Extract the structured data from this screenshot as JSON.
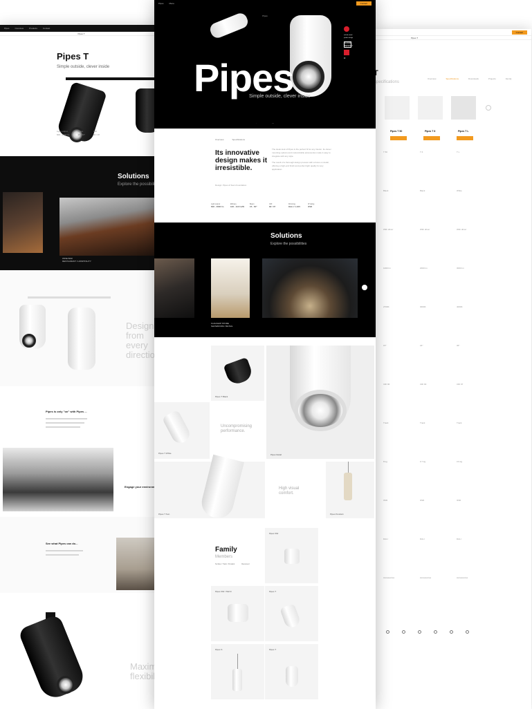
{
  "center": {
    "nav": {
      "items": [
        "Pipes",
        "Menu"
      ],
      "cta": "Contact"
    },
    "subnav": [
      "Pipes"
    ],
    "hero": {
      "title": "Pipes",
      "subtitle": "Simple outside, clever inside",
      "tabs": [
        "",
        ""
      ]
    },
    "awards": [
      "red dot award product design",
      "GOOD DESIGN",
      "iF"
    ],
    "intro": {
      "tabs": [
        "Overview",
        "Specifications"
      ],
      "heading": "Its innovative design makes it irresistible.",
      "note": "Design: Pipes & Team Foundation",
      "paragraphs": [
        "The sleek look of Pipes is the perfect fit for any interior. Its clever mounting options and customizable accessories make it easy to integrate with any style.",
        "The result of a thorough design process with a focus on detail, offering a high-end finish and perfect light quality for any application."
      ],
      "specs": [
        {
          "k": "Light output",
          "v": "600 - 3600 lm"
        },
        {
          "k": "Efficacy",
          "v": "100 - 110 lm/W"
        },
        {
          "k": "Beam",
          "v": "15 - 60°"
        },
        {
          "k": "CRI",
          "v": "90 / 97"
        },
        {
          "k": "Dimming",
          "v": "DALI / 1-10V"
        },
        {
          "k": "IP rating",
          "v": "IP20"
        }
      ]
    },
    "solutions": {
      "title": "Solutions",
      "subtitle": "Explore the possibilities",
      "caption": [
        "FLAGSHIP STORE",
        "SHOWROOM / RETAIL"
      ]
    },
    "gallery": {
      "labels": [
        "Pipes T Black",
        "Pipes T White",
        "Pipes Detail",
        "Pipes T Sun",
        "Pipes Pendant"
      ],
      "texts": [
        "Uncompromising performance.",
        "High visual comfort."
      ]
    },
    "family": {
      "title": "Family",
      "subtitle": "Members",
      "links": [
        "Surface / Track / Pendant",
        "Recessed"
      ],
      "cards": [
        "Pipes SW",
        "Pipes SW / SW-D",
        "Pipes T",
        "Pipes S",
        "Pipes T"
      ]
    }
  },
  "left": {
    "nav": {
      "items": [
        "Pipes",
        "Overview",
        "Products",
        "Contact"
      ],
      "cta": ""
    },
    "subnav": [
      "Pipes T"
    ],
    "title": "Pipes T",
    "subtitle": "Simple outside, clever inside",
    "specs": [
      "Light output",
      "600 - 2400 lm",
      "Beam",
      "15 - 60°",
      "CRI",
      "90 / 97"
    ],
    "solutions": {
      "title": "Solutions",
      "subtitle": "Explore the possibilities",
      "caption": [
        "WINE BAR",
        "RESTAURANT / HOSPITALITY"
      ]
    },
    "big_texts": [
      "Design from every direction",
      "Maximum flexibility"
    ],
    "heads": [
      "Pipes is only \"on\" with Pipes ...",
      "Engage your environment",
      "See what Pipes can do..."
    ]
  },
  "right": {
    "nav": {
      "cta": "Contact"
    },
    "subnav": [
      "Pipes T"
    ],
    "title": "T",
    "subtitle": "Specifications",
    "tabs": [
      "Overview",
      "Specifications",
      "Downloads",
      "Projects",
      "Family"
    ],
    "columns": [
      "Pipes T 50",
      "Pipes T 6",
      "Pipes T L"
    ],
    "rows": [
      [
        "T 50",
        "T 6",
        "T L"
      ],
      [
        "Black",
        "Black",
        "White"
      ],
      [
        "With driver",
        "With driver",
        "With driver"
      ],
      [
        "1000 lm",
        "2000 lm",
        "3000 lm"
      ],
      [
        "2700K",
        "3000K",
        "4000K"
      ],
      [
        "15°",
        "24°",
        "36°"
      ],
      [
        "CRI 90",
        "CRI 90",
        "CRI 97"
      ],
      [
        "Track",
        "Track",
        "Track"
      ],
      [
        "8 kg",
        "0.7 kg",
        "0.9 kg"
      ],
      [
        "IP20",
        "IP20",
        "IP20"
      ],
      [
        "DALI",
        "DALI",
        "DALI"
      ],
      [
        "Accessories",
        "Accessories",
        "Accessories"
      ]
    ]
  },
  "colors": {
    "accent": "#f29a1f",
    "dark": "#000000",
    "award_red": "#d81e2c"
  }
}
